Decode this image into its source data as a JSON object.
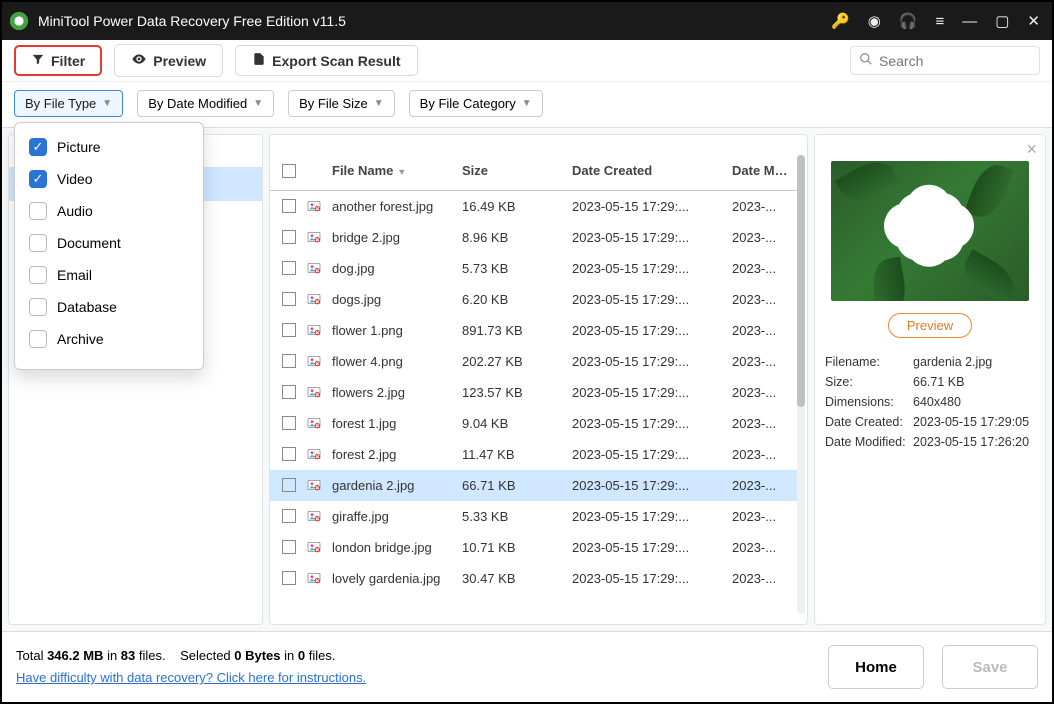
{
  "titlebar": {
    "title": "MiniTool Power Data Recovery Free Edition v11.5"
  },
  "toolbar": {
    "filter_label": "Filter",
    "preview_label": "Preview",
    "export_label": "Export Scan Result",
    "search_placeholder": "Search"
  },
  "filtertabs": {
    "by_type": "By File Type",
    "by_date": "By Date Modified",
    "by_size": "By File Size",
    "by_cat": "By File Category"
  },
  "dropdown": [
    {
      "label": "Picture",
      "checked": true
    },
    {
      "label": "Video",
      "checked": true
    },
    {
      "label": "Audio",
      "checked": false
    },
    {
      "label": "Document",
      "checked": false
    },
    {
      "label": "Email",
      "checked": false
    },
    {
      "label": "Database",
      "checked": false
    },
    {
      "label": "Archive",
      "checked": false
    }
  ],
  "columns": {
    "name": "File Name",
    "size": "Size",
    "created": "Date Created",
    "modified": "Date Modif"
  },
  "files": [
    {
      "name": "another forest.jpg",
      "size": "16.49 KB",
      "created": "2023-05-15 17:29:...",
      "modified": "2023-..."
    },
    {
      "name": "bridge 2.jpg",
      "size": "8.96 KB",
      "created": "2023-05-15 17:29:...",
      "modified": "2023-..."
    },
    {
      "name": "dog.jpg",
      "size": "5.73 KB",
      "created": "2023-05-15 17:29:...",
      "modified": "2023-..."
    },
    {
      "name": "dogs.jpg",
      "size": "6.20 KB",
      "created": "2023-05-15 17:29:...",
      "modified": "2023-..."
    },
    {
      "name": "flower 1.png",
      "size": "891.73 KB",
      "created": "2023-05-15 17:29:...",
      "modified": "2023-..."
    },
    {
      "name": "flower 4.png",
      "size": "202.27 KB",
      "created": "2023-05-15 17:29:...",
      "modified": "2023-..."
    },
    {
      "name": "flowers 2.jpg",
      "size": "123.57 KB",
      "created": "2023-05-15 17:29:...",
      "modified": "2023-..."
    },
    {
      "name": "forest 1.jpg",
      "size": "9.04 KB",
      "created": "2023-05-15 17:29:...",
      "modified": "2023-..."
    },
    {
      "name": "forest 2.jpg",
      "size": "11.47 KB",
      "created": "2023-05-15 17:29:...",
      "modified": "2023-..."
    },
    {
      "name": "gardenia 2.jpg",
      "size": "66.71 KB",
      "created": "2023-05-15 17:29:...",
      "modified": "2023-...",
      "selected": true
    },
    {
      "name": "giraffe.jpg",
      "size": "5.33 KB",
      "created": "2023-05-15 17:29:...",
      "modified": "2023-..."
    },
    {
      "name": "london bridge.jpg",
      "size": "10.71 KB",
      "created": "2023-05-15 17:29:...",
      "modified": "2023-..."
    },
    {
      "name": "lovely gardenia.jpg",
      "size": "30.47 KB",
      "created": "2023-05-15 17:29:...",
      "modified": "2023-..."
    }
  ],
  "preview": {
    "button": "Preview",
    "labels": {
      "filename": "Filename:",
      "size": "Size:",
      "dims": "Dimensions:",
      "created": "Date Created:",
      "modified": "Date Modified:"
    },
    "values": {
      "filename": "gardenia 2.jpg",
      "size": "66.71 KB",
      "dims": "640x480",
      "created": "2023-05-15 17:29:05",
      "modified": "2023-05-15 17:26:20"
    }
  },
  "footer": {
    "total_pre": "Total ",
    "total_size": "346.2 MB",
    "total_mid": " in ",
    "total_count": "83",
    "total_suf": " files.",
    "sel_pre": "Selected ",
    "sel_bytes": "0 Bytes",
    "sel_mid": " in ",
    "sel_count": "0",
    "sel_suf": " files.",
    "help_link": "Have difficulty with data recovery? Click here for instructions.",
    "home": "Home",
    "save": "Save"
  }
}
